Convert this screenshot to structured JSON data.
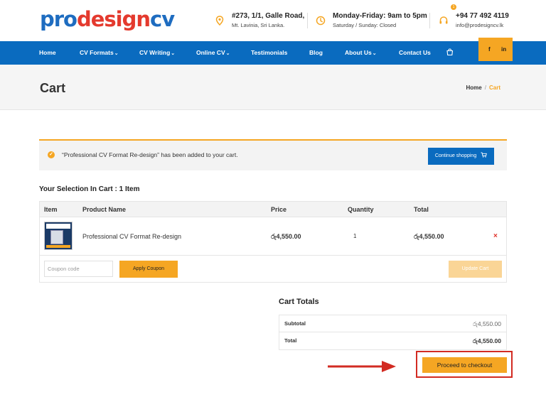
{
  "brand": {
    "part1": "pro",
    "part2": "design",
    "part3": "cv"
  },
  "header": {
    "address": {
      "main": "#273, 1/1, Galle Road,",
      "sub": "Mt. Lavinia, Sri Lanka."
    },
    "hours": {
      "main": "Monday-Friday: 9am to 5pm",
      "sub": "Saturday / Sunday: Closed"
    },
    "contact": {
      "phone": "+94 77 492 4119",
      "email": "info@prodesigncv.lk"
    }
  },
  "nav": {
    "items": [
      {
        "label": "Home",
        "caret": ""
      },
      {
        "label": "CV Formats",
        "caret": "⌄"
      },
      {
        "label": "CV Writing",
        "caret": "⌄"
      },
      {
        "label": "Online CV",
        "caret": "⌄"
      },
      {
        "label": "Testimonials",
        "caret": ""
      },
      {
        "label": "Blog",
        "caret": ""
      },
      {
        "label": "About Us",
        "caret": "⌄"
      },
      {
        "label": "Contact Us",
        "caret": ""
      }
    ],
    "cart_count": "1",
    "social": {
      "facebook": "f",
      "linkedin": "in"
    }
  },
  "page": {
    "title": "Cart",
    "breadcrumb": {
      "home": "Home",
      "separator": "/",
      "current": "Cart"
    }
  },
  "notice": {
    "message": "“Professional CV Format Re-design” has been added to your cart.",
    "button": "Continue shopping"
  },
  "cart": {
    "heading": "Your Selection In Cart : 1 Item",
    "columns": {
      "item": "Item",
      "product": "Product Name",
      "price": "Price",
      "quantity": "Quantity",
      "total": "Total"
    },
    "rows": [
      {
        "product": "Professional CV Format Re-design",
        "price": "රු4,550.00",
        "quantity": "1",
        "total": "රු4,550.00",
        "remove": "×"
      }
    ],
    "coupon_placeholder": "Coupon code",
    "apply_label": "Apply Coupon",
    "update_label": "Update Cart"
  },
  "totals": {
    "heading": "Cart Totals",
    "subtotal_label": "Subtotal",
    "subtotal": "රු4,550.00",
    "total_label": "Total",
    "total": "රු4,550.00",
    "checkout_label": "Proceed to checkout"
  },
  "colors": {
    "primary_blue": "#0a6bbf",
    "accent_orange": "#f5a623",
    "highlight_red": "#d22b22"
  }
}
